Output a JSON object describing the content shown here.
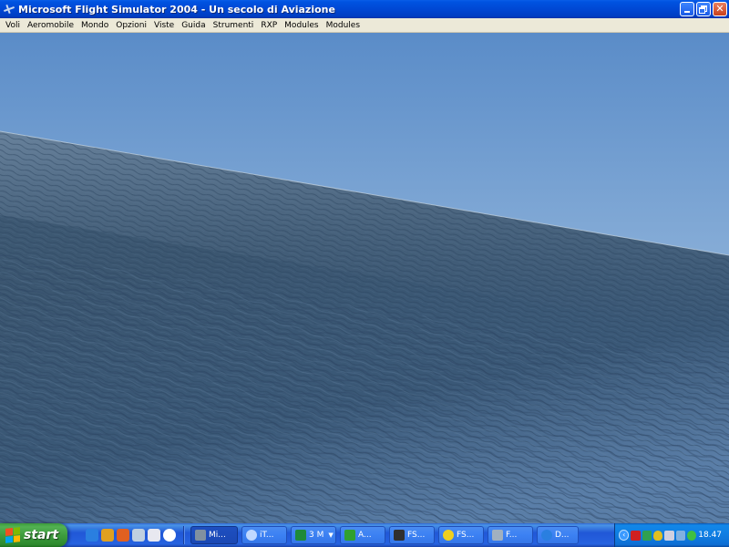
{
  "window": {
    "title": "Microsoft Flight Simulator 2004 - Un secolo di Aviazione",
    "icon": "airplane-icon",
    "buttons": [
      "minimize-icon",
      "restore-icon",
      "close-icon"
    ]
  },
  "menubar": {
    "items": [
      "Voli",
      "Aeromobile",
      "Mondo",
      "Opzioni",
      "Viste",
      "Guida",
      "Strumenti",
      "RXP",
      "Modules",
      "Modules"
    ]
  },
  "scene": {
    "sky_top": "#5d8fc9",
    "sky_horizon": "#c9dcea",
    "water": "#3e5b78",
    "water_dark": "#2f4963"
  },
  "taskbar": {
    "start_label": "start",
    "quick_launch": [
      {
        "icon": "internet-explorer-icon",
        "color": "#2a7fe0"
      },
      {
        "icon": "media-player-icon",
        "color": "#e0a020"
      },
      {
        "icon": "firefox-icon",
        "color": "#e06020"
      },
      {
        "icon": "network-icon",
        "color": "#c0d0e0"
      },
      {
        "icon": "mail-icon",
        "color": "#e8e8f0"
      },
      {
        "icon": "player-icon",
        "color": "#ffffff"
      }
    ],
    "tasks": [
      {
        "label": "Mi...",
        "icon": "airplane-icon",
        "color": "#8090a0",
        "active": true
      },
      {
        "label": "iT...",
        "icon": "itunes-icon",
        "color": "#c0d8ff",
        "active": false
      },
      {
        "label": "3 M",
        "icon": "excel-icon",
        "color": "#1e8a3a",
        "active": false,
        "group": true
      },
      {
        "label": "A...",
        "icon": "app-icon",
        "color": "#30a030",
        "active": false
      },
      {
        "label": "FS...",
        "icon": "window-icon",
        "color": "#303030",
        "active": false
      },
      {
        "label": "FS...",
        "icon": "smiley-icon",
        "color": "#f0d020",
        "active": false
      },
      {
        "label": "F...",
        "icon": "airplane-icon",
        "color": "#a0b0c0",
        "active": false
      },
      {
        "label": "D...",
        "icon": "internet-explorer-icon",
        "color": "#2a7fe0",
        "active": false
      }
    ],
    "tray": {
      "icons": [
        {
          "icon": "antivirus-icon",
          "color": "#d02020"
        },
        {
          "icon": "wireless-icon",
          "color": "#30a050"
        },
        {
          "icon": "security-shield-icon",
          "color": "#e0c020"
        },
        {
          "icon": "volume-icon",
          "color": "#d0d0e0"
        },
        {
          "icon": "network-connection-icon",
          "color": "#80b0e0"
        },
        {
          "icon": "messenger-icon",
          "color": "#40c040"
        },
        {
          "icon": "update-icon",
          "color": "#e04040"
        }
      ],
      "clock": "18.47"
    }
  }
}
